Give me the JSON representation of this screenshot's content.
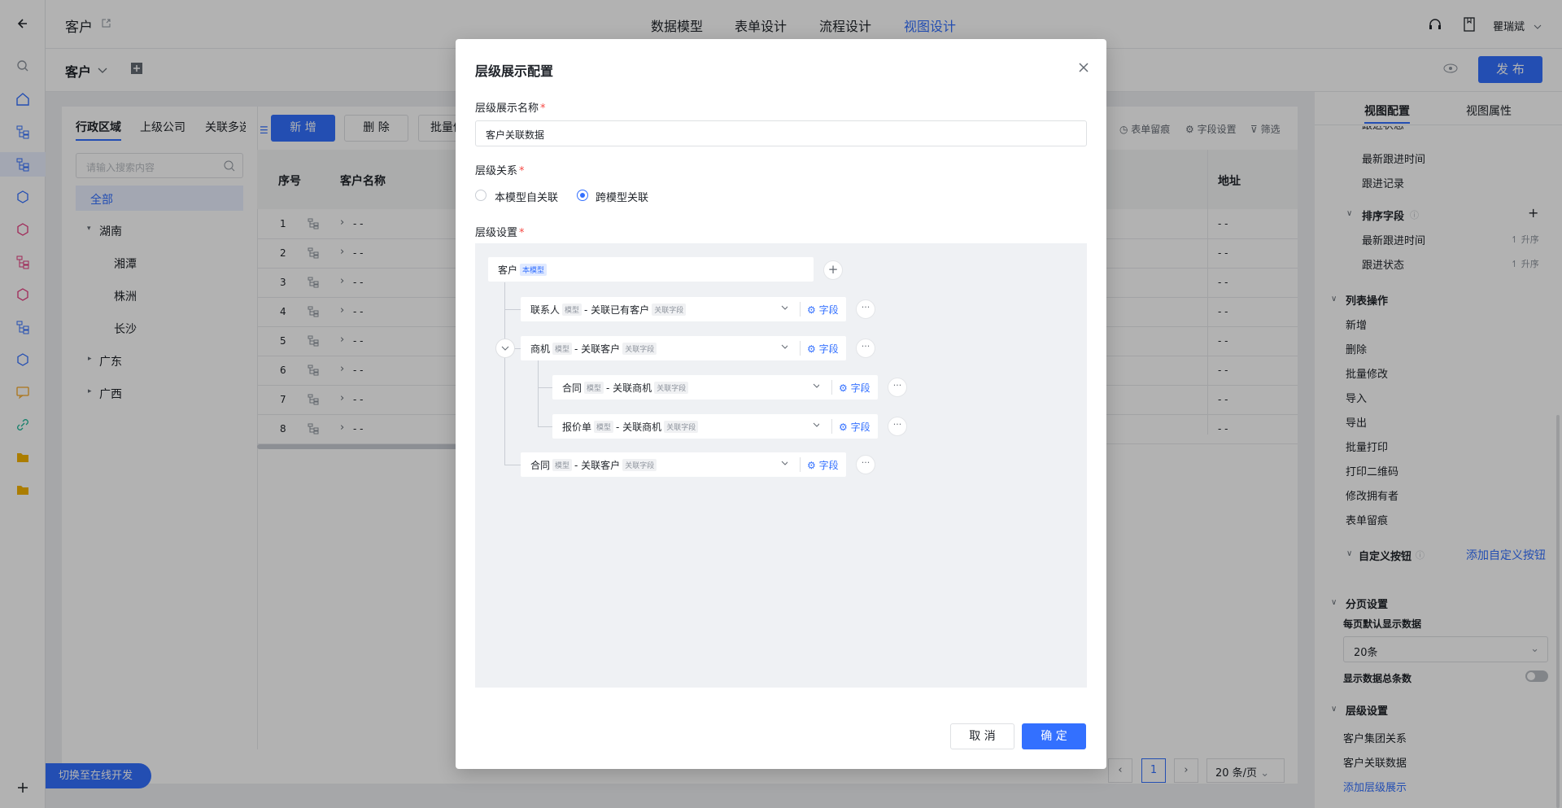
{
  "topbar": {
    "title": "客户",
    "tabs": [
      "数据模型",
      "表单设计",
      "流程设计",
      "视图设计"
    ],
    "active_tab": "视图设计",
    "user": "瞿瑞斌"
  },
  "subbar": {
    "view_name": "客户",
    "publish_label": "发 布"
  },
  "left_tabs": [
    "行政区域",
    "上级公司",
    "关联多选"
  ],
  "left_search_placeholder": "请输入搜索内容",
  "tree": {
    "all": "全部",
    "hunan": "湖南",
    "xiangtan": "湘潭",
    "zhuzhou": "株洲",
    "changsha": "长沙",
    "guangdong": "广东",
    "guangxi": "广西"
  },
  "toolbar": {
    "add": "新 增",
    "delete": "删 除",
    "batch": "批量修",
    "form_trace": "表单留痕",
    "field_settings": "字段设置",
    "filter": "筛选"
  },
  "table": {
    "col_seq": "序号",
    "col_name": "客户名称",
    "col_addr": "地址",
    "rows": [
      {
        "n": "1",
        "v": "- -",
        "a": "- -"
      },
      {
        "n": "2",
        "v": "- -",
        "a": "- -"
      },
      {
        "n": "3",
        "v": "- -",
        "a": "- -"
      },
      {
        "n": "4",
        "v": "- -",
        "a": "- -"
      },
      {
        "n": "5",
        "v": "- -",
        "a": "- -"
      },
      {
        "n": "6",
        "v": "- -",
        "a": "- -"
      },
      {
        "n": "7",
        "v": "- -",
        "a": "- -"
      },
      {
        "n": "8",
        "v": "- -",
        "a": "- -"
      }
    ]
  },
  "pagination": {
    "page": "1",
    "page_size": "20 条/页"
  },
  "switch_online": "切换至在线开发",
  "right_panel": {
    "tabs": [
      "视图配置",
      "视图属性"
    ],
    "top_items": [
      "跟进状态",
      "最新跟进时间",
      "跟进记录"
    ],
    "sort_title": "排序字段",
    "sort_items": [
      {
        "label": "最新跟进时间",
        "order": "升序"
      },
      {
        "label": "跟进状态",
        "order": "升序"
      }
    ],
    "list_ops_title": "列表操作",
    "list_ops": [
      "新增",
      "删除",
      "批量修改",
      "导入",
      "导出",
      "批量打印",
      "打印二维码",
      "修改拥有者",
      "表单留痕"
    ],
    "custom_btn": "自定义按钮",
    "add_custom_btn": "添加自定义按钮",
    "paging_title": "分页设置",
    "per_page_label": "每页默认显示数据",
    "per_page_value": "20条",
    "show_total_label": "显示数据总条数",
    "level_title": "层级设置",
    "level_items": [
      "客户集团关系",
      "客户关联数据"
    ],
    "add_level": "添加层级展示"
  },
  "modal": {
    "title": "层级展示配置",
    "name_label": "层级展示名称",
    "name_value": "客户关联数据",
    "relation_label": "层级关系",
    "relation_options": [
      "本模型自关联",
      "跨模型关联"
    ],
    "relation_selected": "跨模型关联",
    "settings_label": "层级设置",
    "root": {
      "name": "客户",
      "tag": "本模型"
    },
    "nodes": [
      {
        "model": "联系人",
        "model_tag": "模型",
        "rel": "- 关联已有客户",
        "rel_tag": "关联字段",
        "field": "字段"
      },
      {
        "model": "商机",
        "model_tag": "模型",
        "rel": "- 关联客户",
        "rel_tag": "关联字段",
        "field": "字段"
      },
      {
        "model": "合同",
        "model_tag": "模型",
        "rel": "- 关联商机",
        "rel_tag": "关联字段",
        "field": "字段"
      },
      {
        "model": "报价单",
        "model_tag": "模型",
        "rel": "- 关联商机",
        "rel_tag": "关联字段",
        "field": "字段"
      },
      {
        "model": "合同",
        "model_tag": "模型",
        "rel": "- 关联客户",
        "rel_tag": "关联字段",
        "field": "字段"
      }
    ],
    "more": "···",
    "cancel": "取 消",
    "confirm": "确 定"
  },
  "colors": {
    "primary": "#3370ff",
    "required": "#f54a45"
  }
}
